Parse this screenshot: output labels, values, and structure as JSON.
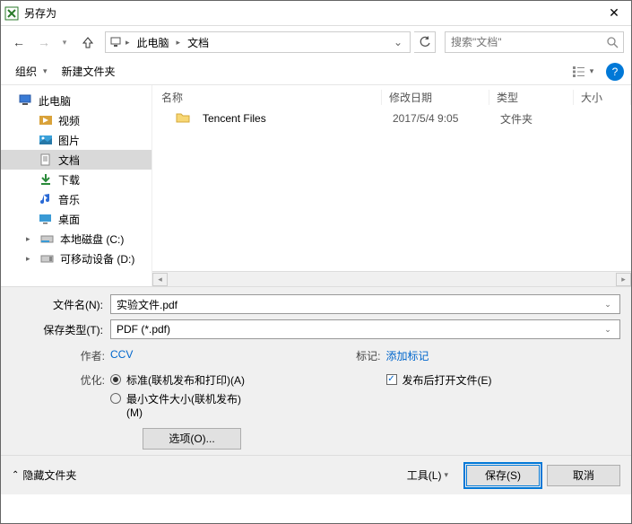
{
  "window": {
    "title": "另存为"
  },
  "nav": {
    "breadcrumb": [
      "此电脑",
      "文档"
    ],
    "search_placeholder": "搜索\"文档\""
  },
  "toolbar": {
    "organize": "组织",
    "new_folder": "新建文件夹"
  },
  "tree": [
    {
      "label": "此电脑",
      "icon": "pc",
      "lv": 1,
      "sel": false
    },
    {
      "label": "视频",
      "icon": "video",
      "lv": 2,
      "sel": false
    },
    {
      "label": "图片",
      "icon": "picture",
      "lv": 2,
      "sel": false
    },
    {
      "label": "文档",
      "icon": "document",
      "lv": 2,
      "sel": true
    },
    {
      "label": "下载",
      "icon": "download",
      "lv": 2,
      "sel": false
    },
    {
      "label": "音乐",
      "icon": "music",
      "lv": 2,
      "sel": false
    },
    {
      "label": "桌面",
      "icon": "desktop",
      "lv": 2,
      "sel": false
    },
    {
      "label": "本地磁盘 (C:)",
      "icon": "disk",
      "lv": 2,
      "sel": false
    },
    {
      "label": "可移动设备 (D:)",
      "icon": "usb",
      "lv": 2,
      "sel": false
    }
  ],
  "columns": {
    "name": "名称",
    "date": "修改日期",
    "type": "类型",
    "size": "大小"
  },
  "rows": [
    {
      "name": "Tencent Files",
      "date": "2017/5/4 9:05",
      "type": "文件夹"
    }
  ],
  "filename": {
    "label": "文件名(N):",
    "value": "实验文件.pdf"
  },
  "filetype": {
    "label": "保存类型(T):",
    "value": "PDF (*.pdf)"
  },
  "meta": {
    "author_label": "作者:",
    "author": "CCV",
    "tags_label": "标记:",
    "tags": "添加标记",
    "optimize_label": "优化:",
    "opt_standard": "标准(联机发布和打印)(A)",
    "opt_min": "最小文件大小(联机发布)(M)",
    "open_after": "发布后打开文件(E)",
    "options_btn": "选项(O)..."
  },
  "bottom": {
    "hide_folders": "隐藏文件夹",
    "tools": "工具(L)",
    "save": "保存(S)",
    "cancel": "取消"
  }
}
